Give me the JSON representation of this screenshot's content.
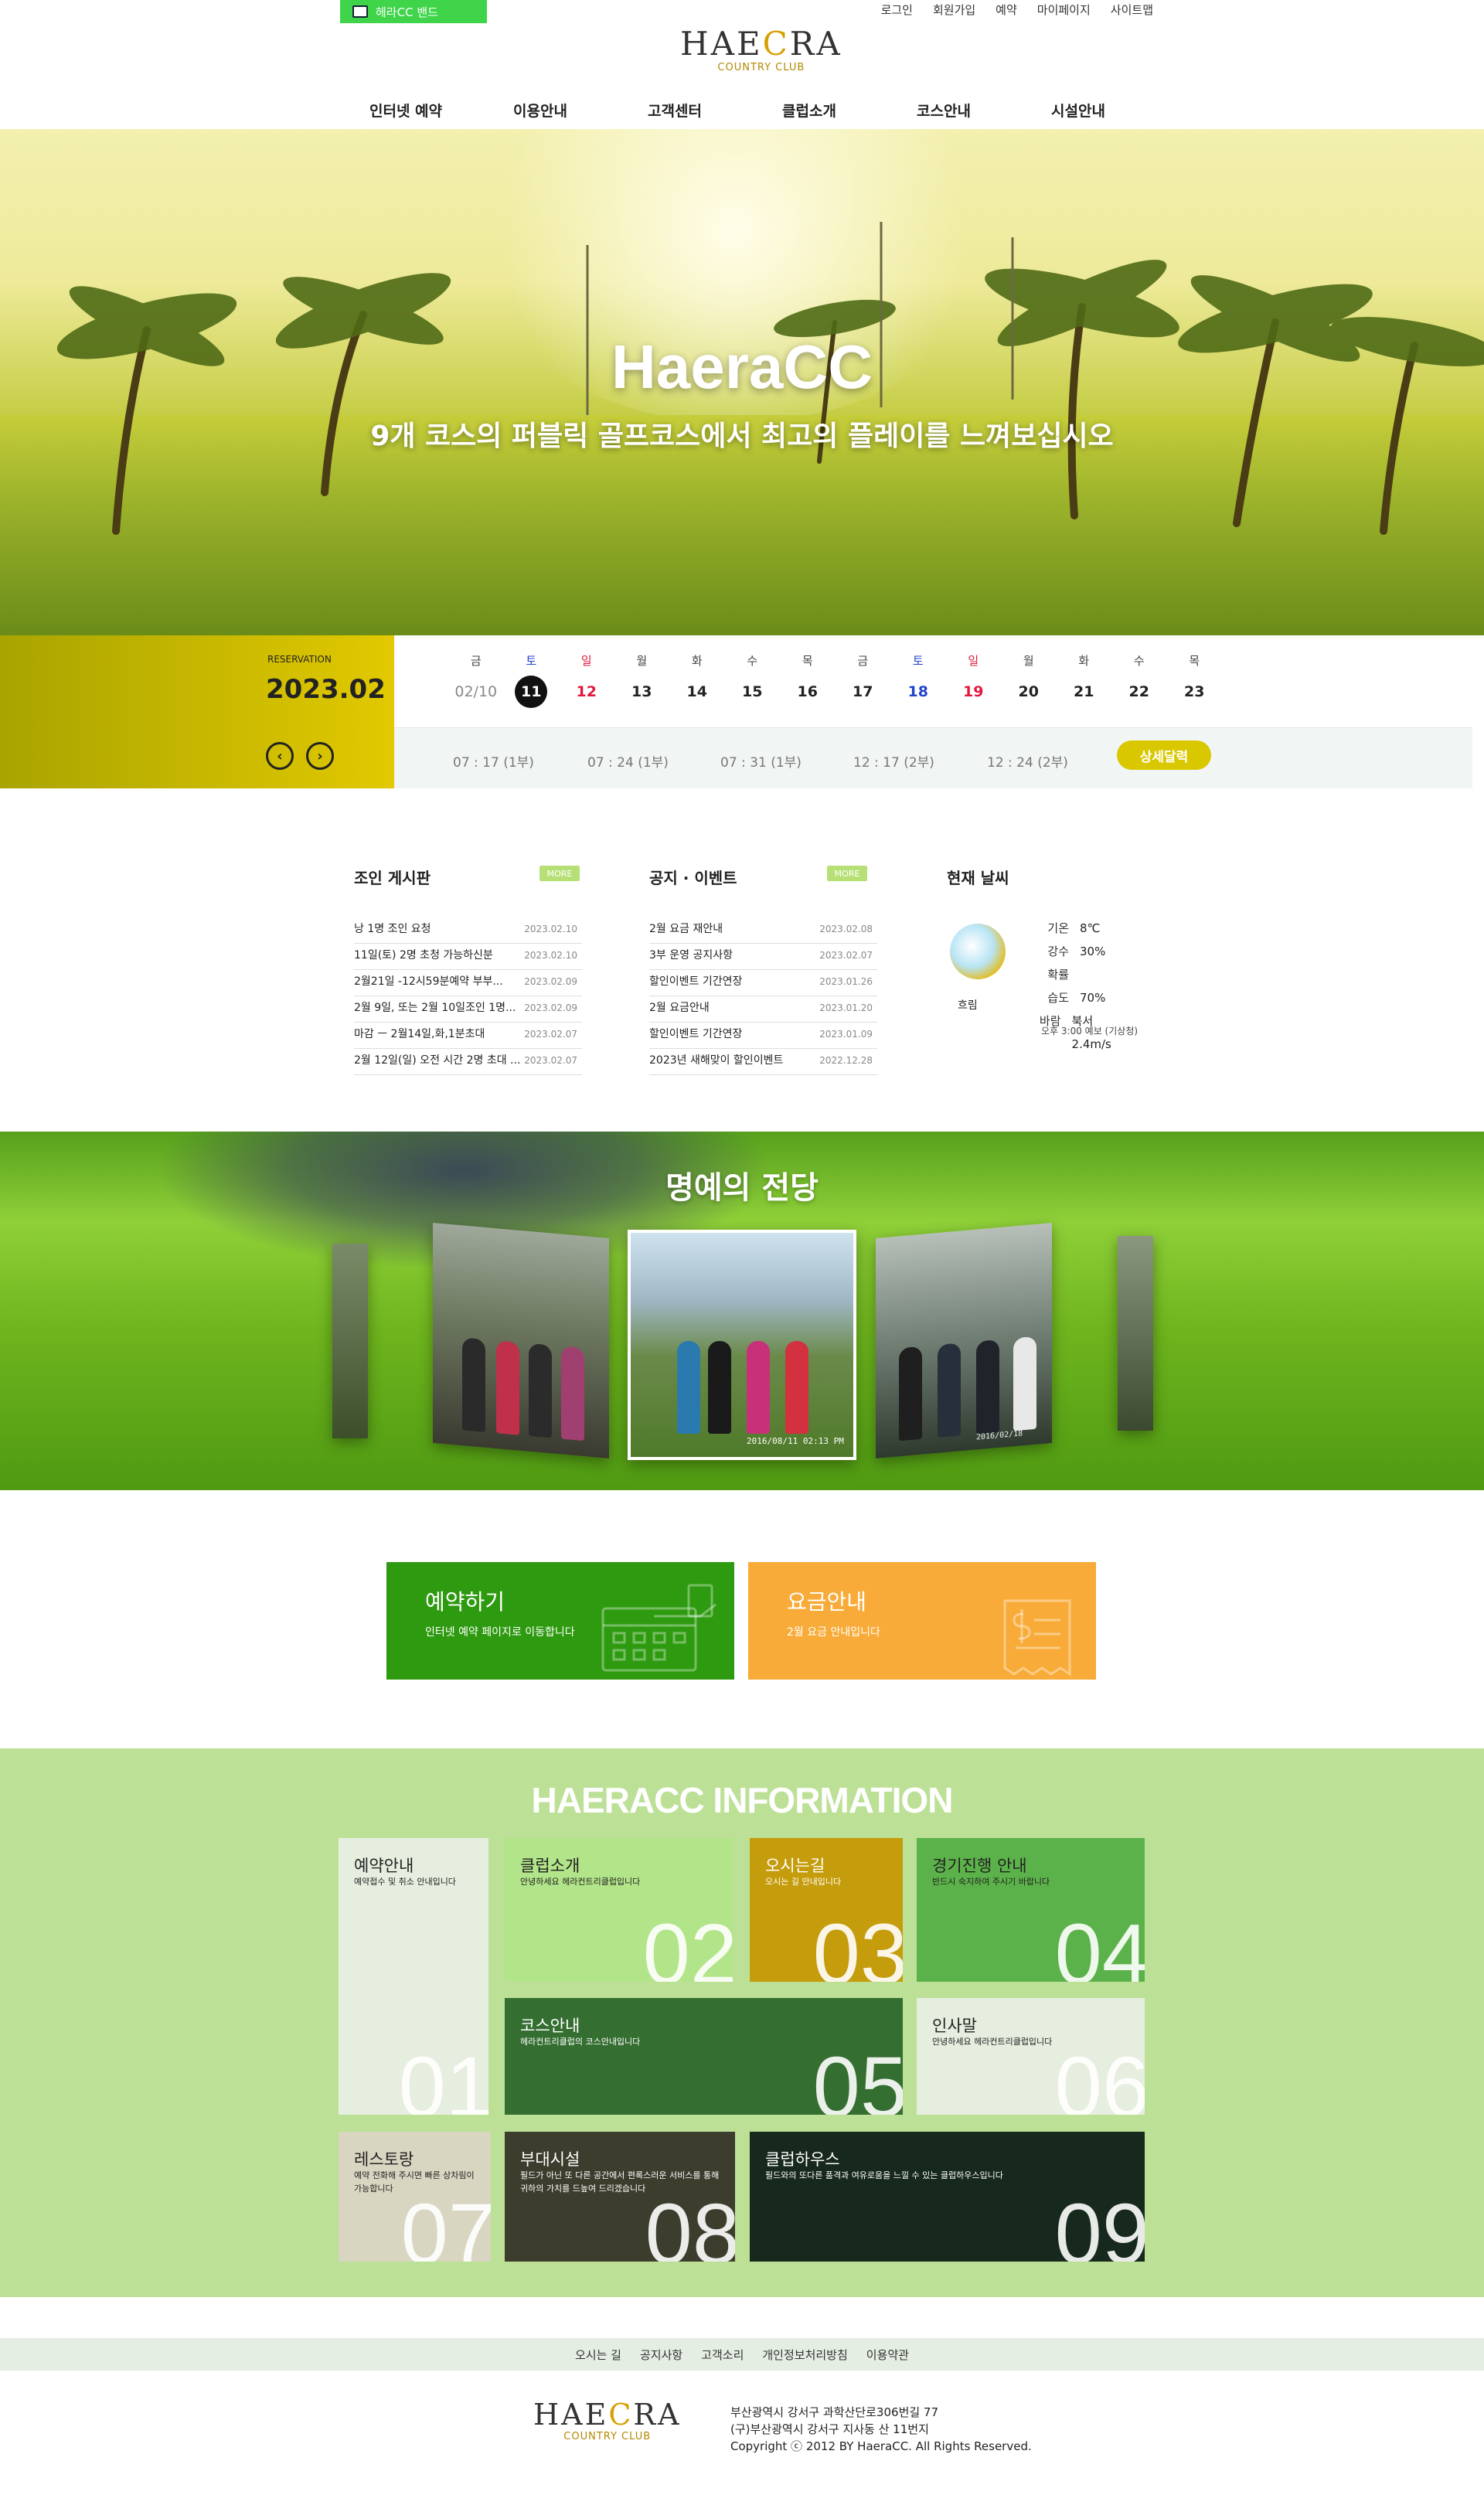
{
  "band": {
    "label": "헤라CC 밴드"
  },
  "util": [
    "로그인",
    "회원가입",
    "예약",
    "마이페이지",
    "사이트맵"
  ],
  "logo": {
    "word_a": "HAE",
    "word_mid": "C",
    "word_b": "RA",
    "sub": "COUNTRY CLUB"
  },
  "gnb": [
    "인터넷 예약",
    "이용안내",
    "고객센터",
    "클럽소개",
    "코스안내",
    "시설안내"
  ],
  "hero": {
    "title": "HaeraCC",
    "subtitle": "9개 코스의 퍼블릭 골프코스에서 최고의 플레이를 느껴보십시오"
  },
  "reservation": {
    "label": "RESERVATION",
    "year_month": "2023.02",
    "prev": "‹",
    "next": "›"
  },
  "calendar": {
    "days": [
      {
        "w": "금",
        "n": "02/10",
        "type": "gray"
      },
      {
        "w": "토",
        "n": "11",
        "type": "current"
      },
      {
        "w": "일",
        "n": "12",
        "type": "sun"
      },
      {
        "w": "월",
        "n": "13",
        "type": ""
      },
      {
        "w": "화",
        "n": "14",
        "type": ""
      },
      {
        "w": "수",
        "n": "15",
        "type": ""
      },
      {
        "w": "목",
        "n": "16",
        "type": ""
      },
      {
        "w": "금",
        "n": "17",
        "type": ""
      },
      {
        "w": "토",
        "n": "18",
        "type": "sat"
      },
      {
        "w": "일",
        "n": "19",
        "type": "sun"
      },
      {
        "w": "월",
        "n": "20",
        "type": ""
      },
      {
        "w": "화",
        "n": "21",
        "type": ""
      },
      {
        "w": "수",
        "n": "22",
        "type": ""
      },
      {
        "w": "목",
        "n": "23",
        "type": ""
      }
    ],
    "times": [
      "07 : 17 (1부)",
      "07 : 24 (1부)",
      "07 : 31 (1부)",
      "12 : 17 (2부)",
      "12 : 24 (2부)"
    ],
    "detail": "상세달력"
  },
  "boards": [
    {
      "title": "조인 게시판",
      "more": "MORE",
      "items": [
        {
          "t": "낭 1명 조인 요청",
          "d": "2023.02.10"
        },
        {
          "t": "11일(토) 2명 초청 가능하신분",
          "d": "2023.02.10"
        },
        {
          "t": "2월21일 -12시59분예약 부부...",
          "d": "2023.02.09"
        },
        {
          "t": "2월 9일, 또는 2월 10일조인 1명...",
          "d": "2023.02.09"
        },
        {
          "t": "마감 ㅡ 2월14일,화,1분초대",
          "d": "2023.02.07"
        },
        {
          "t": "2월 12일(일) 오전 시간 2명 초대 ...",
          "d": "2023.02.07"
        }
      ]
    },
    {
      "title": "공지 · 이벤트",
      "more": "MORE",
      "items": [
        {
          "t": "2월 요금 재안내",
          "d": "2023.02.08"
        },
        {
          "t": "3부 운영 공지사항",
          "d": "2023.02.07"
        },
        {
          "t": "할인이벤트 기간연장",
          "d": "2023.01.26"
        },
        {
          "t": "2월 요금안내",
          "d": "2023.01.20"
        },
        {
          "t": "할인이벤트 기간연장",
          "d": "2023.01.09"
        },
        {
          "t": "2023년 새해맞이 할인이벤트",
          "d": "2022.12.28"
        }
      ]
    }
  ],
  "weather": {
    "title": "현재 날씨",
    "state": "흐림",
    "rows": [
      {
        "k": "기온",
        "v": "8℃"
      },
      {
        "k": "강수확률",
        "v": "30%"
      },
      {
        "k": "습도",
        "v": "70%"
      },
      {
        "k": "바람",
        "v": "북서 2.4m/s"
      }
    ],
    "note": "오후 3:00 예보 (기상청)"
  },
  "hall_of_fame": {
    "title": "명예의 전당",
    "stamp_center": "2016/08/11 02:13 PM",
    "stamp_right": "2016/02/18"
  },
  "cta": [
    {
      "title": "예약하기",
      "desc": "인터넷 예약 페이지로 이동합니다",
      "color": "#2e9a10"
    },
    {
      "title": "요금안내",
      "desc": "2월 요금 안내입니다",
      "color": "#f8ab38"
    }
  ],
  "info": {
    "title": "HAERACC INFORMATION",
    "tiles": [
      {
        "title": "예약안내",
        "desc": "예약접수 및 취소 안내입니다",
        "num": "01",
        "bg": "#e6eedf",
        "fg": "#222"
      },
      {
        "title": "클럽소개",
        "desc": "안녕하세요 헤라컨트리클럽입니다",
        "num": "02",
        "bg": "#b2e489",
        "fg": "#222"
      },
      {
        "title": "오시는길",
        "desc": "오시는 길 안내입니다",
        "num": "03",
        "bg": "#c59c0b",
        "fg": "#fff"
      },
      {
        "title": "경기진행 안내",
        "desc": "반드시 숙지하여 주시기 바랍니다",
        "num": "04",
        "bg": "#5cb24a",
        "fg": "#222"
      },
      {
        "title": "코스안내",
        "desc": "헤라컨트리클럽의 코스안내입니다",
        "num": "05",
        "bg": "#346e31",
        "fg": "#fff"
      },
      {
        "title": "인사말",
        "desc": "안녕하세요 헤라컨트리클럽입니다",
        "num": "06",
        "bg": "#e6eedf",
        "fg": "#222"
      },
      {
        "title": "레스토랑",
        "desc": "예약 전화해 주시면 빠른 상차림이 가능합니다",
        "num": "07",
        "bg": "#d8d5c0",
        "fg": "#222"
      },
      {
        "title": "부대시설",
        "desc": "필드가 아닌 또 다른 공간에서 편록스러운 서비스를 통해 귀하의 가치를 드높여 드리겠습니다",
        "num": "08",
        "bg": "#3d3d2e",
        "fg": "#fff"
      },
      {
        "title": "클럽하우스",
        "desc": "필드와의 또다른 품격과 여유로움을 느낄 수 있는 클럽하우스입니다",
        "num": "09",
        "bg": "#17281d",
        "fg": "#fff"
      }
    ]
  },
  "footer": {
    "links": [
      "오시는 길",
      "공지사항",
      "고객소리",
      "개인정보처리방침",
      "이용약관"
    ],
    "address1": "부산광역시 강서구 과학산단로306번길 77",
    "address2": "(구)부산광역시 강서구 지사동 산 11번지",
    "copyright": "Copyright ⓒ 2012 BY HaeraCC. All Rights Reserved."
  }
}
